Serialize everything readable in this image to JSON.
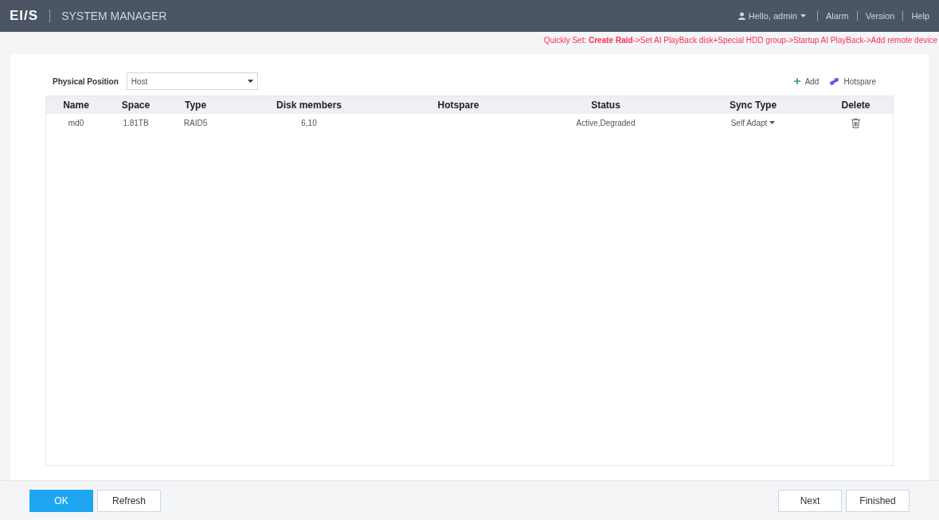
{
  "header": {
    "logo": "EI/S",
    "title": "SYSTEM MANAGER",
    "user": "Hello, admin",
    "links": [
      "Alarm",
      "Version",
      "Help"
    ]
  },
  "quick_set": "Quickly Set: **Create Raid**->Set AI PlayBack disk+Special HDD group->Startup AI PlayBack->Add remote device",
  "physical_position": {
    "label": "Physical Position",
    "value": "Host"
  },
  "toolbar": [
    {
      "kind": "add",
      "label": "Add"
    },
    {
      "kind": "hotspare",
      "label": "Hotspare"
    }
  ],
  "table": {
    "columns": [
      "Name",
      "Space",
      "Type",
      "Disk members",
      "Hotspare",
      "Status",
      "Sync Type",
      "Delete"
    ],
    "rows": [
      {
        "name": "md0",
        "space": "1.81TB",
        "type": "RAID5",
        "disk_members": "6,10",
        "status": "Active,Degraded",
        "sync_type": "Self Adapt"
      }
    ]
  },
  "footer": {
    "left": [
      {
        "label": "OK",
        "primary": true
      },
      {
        "label": "Refresh",
        "primary": false
      }
    ],
    "right": [
      {
        "label": "Next",
        "primary": false
      },
      {
        "label": "Finished",
        "primary": false
      }
    ]
  }
}
